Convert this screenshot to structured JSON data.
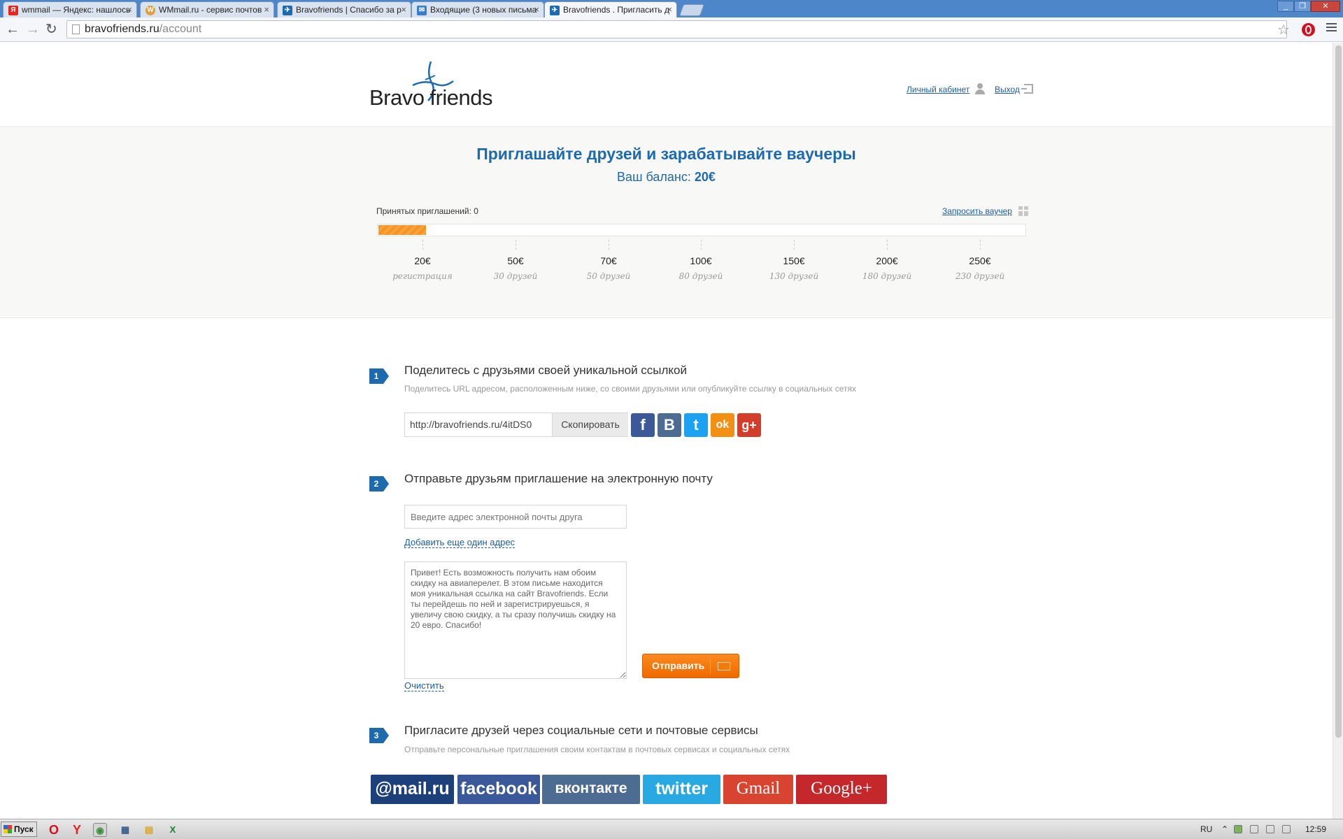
{
  "browser": {
    "tabs": [
      {
        "title": "wmmail — Яндекс: нашлось",
        "icon": "yandex-icon",
        "color": "#e52620",
        "glyph": "Я"
      },
      {
        "title": "WMmail.ru - сервис почтов",
        "icon": "wmmail-icon",
        "color": "#e0a040",
        "glyph": "W"
      },
      {
        "title": "Bravofriends | Спасибо за р",
        "icon": "bravofriends-icon",
        "color": "#1d6aaf",
        "glyph": "✈"
      },
      {
        "title": "Входящие (3 новых письма",
        "icon": "mail-icon",
        "color": "#3a7dc9",
        "glyph": "✉"
      },
      {
        "title": "Bravofriends . Пригласить д",
        "icon": "bravofriends-icon",
        "color": "#1d6aaf",
        "glyph": "✈"
      }
    ],
    "url_host": "bravofriends.ru",
    "url_path": "/account"
  },
  "header": {
    "logo_word1": "Bravo",
    "logo_word2": "friends",
    "account_link": "Личный кабинет",
    "logout_link": "Выход"
  },
  "progress": {
    "title": "Приглашайте друзей и зарабатывайте ваучеры",
    "balance_label": "Ваш баланс:",
    "balance_value": "20€",
    "accepted_invites": "Принятых приглашений: 0",
    "request_voucher": "Запросить ваучер",
    "fill_fraction": 0.073,
    "milestones": [
      {
        "amount": "20€",
        "note": "регистрация"
      },
      {
        "amount": "50€",
        "note": "30 друзей"
      },
      {
        "amount": "70€",
        "note": "50 друзей"
      },
      {
        "amount": "100€",
        "note": "80 друзей"
      },
      {
        "amount": "150€",
        "note": "130 друзей"
      },
      {
        "amount": "200€",
        "note": "180 друзей"
      },
      {
        "amount": "250€",
        "note": "230 друзей"
      }
    ]
  },
  "step1": {
    "number": "1",
    "title": "Поделитесь с друзьями своей уникальной ссылкой",
    "subtitle": "Поделитесь URL адресом, расположенным ниже, со своими друзьями или опубликуйте ссылку в социальных сетях",
    "share_url": "http://bravofriends.ru/4itDS0",
    "copy_label": "Скопировать",
    "social": [
      {
        "name": "facebook",
        "glyph": "f",
        "color": "#3b5998"
      },
      {
        "name": "vkontakte",
        "glyph": "B",
        "color": "#4c6c91"
      },
      {
        "name": "twitter",
        "glyph": "t",
        "color": "#1da1f2"
      },
      {
        "name": "odnoklassniki",
        "glyph": "ok",
        "color": "#f39014"
      },
      {
        "name": "google-plus",
        "glyph": "g+",
        "color": "#d23e2b"
      }
    ]
  },
  "step2": {
    "number": "2",
    "title": "Отправьте друзьям приглашение на электронную почту",
    "email_placeholder": "Введите адрес электронной почты друга",
    "add_address": "Добавить еще один адрес",
    "message": "Привет! Есть возможность получить нам обоим\nскидку на авиаперелет. В этом письме находится\nмоя уникальная ссылка на сайт Bravofriends. Если\nты перейдешь по ней и зарегистрируешься, я\nувеличу свою скидку, а ты сразу получишь скидку на\n20 евро. Спасибо!",
    "clear": "Очистить",
    "send": "Отправить"
  },
  "step3": {
    "number": "3",
    "title": "Пригласите друзей через социальные сети и почтовые сервисы",
    "subtitle": "Отправьте персональные приглашения своим контактам в почтовых сервисах и социальных сетях",
    "services": [
      {
        "name": "mailru",
        "label": "@mail.ru",
        "color": "#1d3f7a"
      },
      {
        "name": "facebook",
        "label": "facebook",
        "color": "#3b5998"
      },
      {
        "name": "vkontakte",
        "label": "вконтакте",
        "color": "#4c6c91"
      },
      {
        "name": "twitter",
        "label": "twitter",
        "color": "#29a9e1"
      },
      {
        "name": "gmail",
        "label": "Gmail",
        "color": "#d8442f"
      },
      {
        "name": "google-plus",
        "label": "Google+",
        "color": "#c5282b"
      }
    ]
  },
  "taskbar": {
    "start": "Пуск",
    "lang": "RU",
    "time": "12:59"
  }
}
